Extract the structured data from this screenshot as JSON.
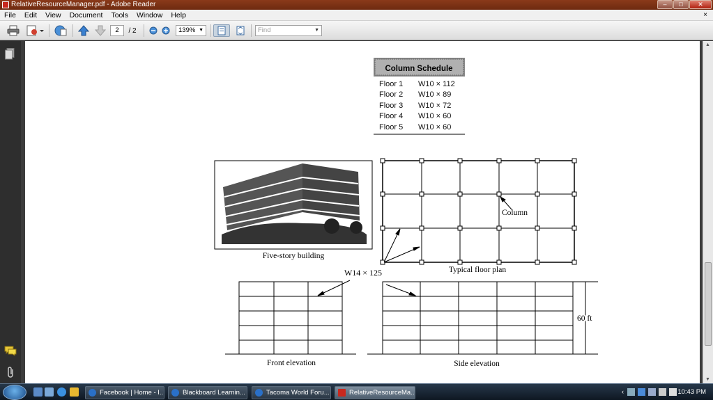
{
  "window": {
    "title": "RelativeResourceManager.pdf - Adobe Reader",
    "controls": [
      "–",
      "□",
      "✕"
    ]
  },
  "menu": {
    "items": [
      "File",
      "Edit",
      "View",
      "Document",
      "Tools",
      "Window",
      "Help"
    ],
    "close_symbol": "×"
  },
  "toolbar": {
    "page_current": "2",
    "page_total": "/ 2",
    "zoom": "139%",
    "find_placeholder": "Find"
  },
  "document": {
    "schedule_title": "Column Schedule",
    "schedule_rows": [
      [
        "Floor 1",
        "W10 × 112"
      ],
      [
        "Floor 2",
        "W10 × 89"
      ],
      [
        "Floor 3",
        "W10 × 72"
      ],
      [
        "Floor 4",
        "W10 × 60"
      ],
      [
        "Floor 5",
        "W10 × 60"
      ]
    ],
    "building_caption": "Five-story building",
    "floor_plan_caption": "Typical floor plan",
    "column_label": "Column",
    "beam_label": "W14 × 125",
    "front_caption": "Front elevation",
    "side_caption": "Side elevation",
    "height_label": "60 ft"
  },
  "taskbar": {
    "items": [
      {
        "label": "Facebook | Home - I...",
        "color": "#2a70c8"
      },
      {
        "label": "Blackboard Learnin...",
        "color": "#2a70c8"
      },
      {
        "label": "Tacoma World Foru...",
        "color": "#2a70c8"
      },
      {
        "label": "RelativeResourceMa...",
        "color": "#c8281e"
      }
    ],
    "clock": "10:43 PM"
  }
}
